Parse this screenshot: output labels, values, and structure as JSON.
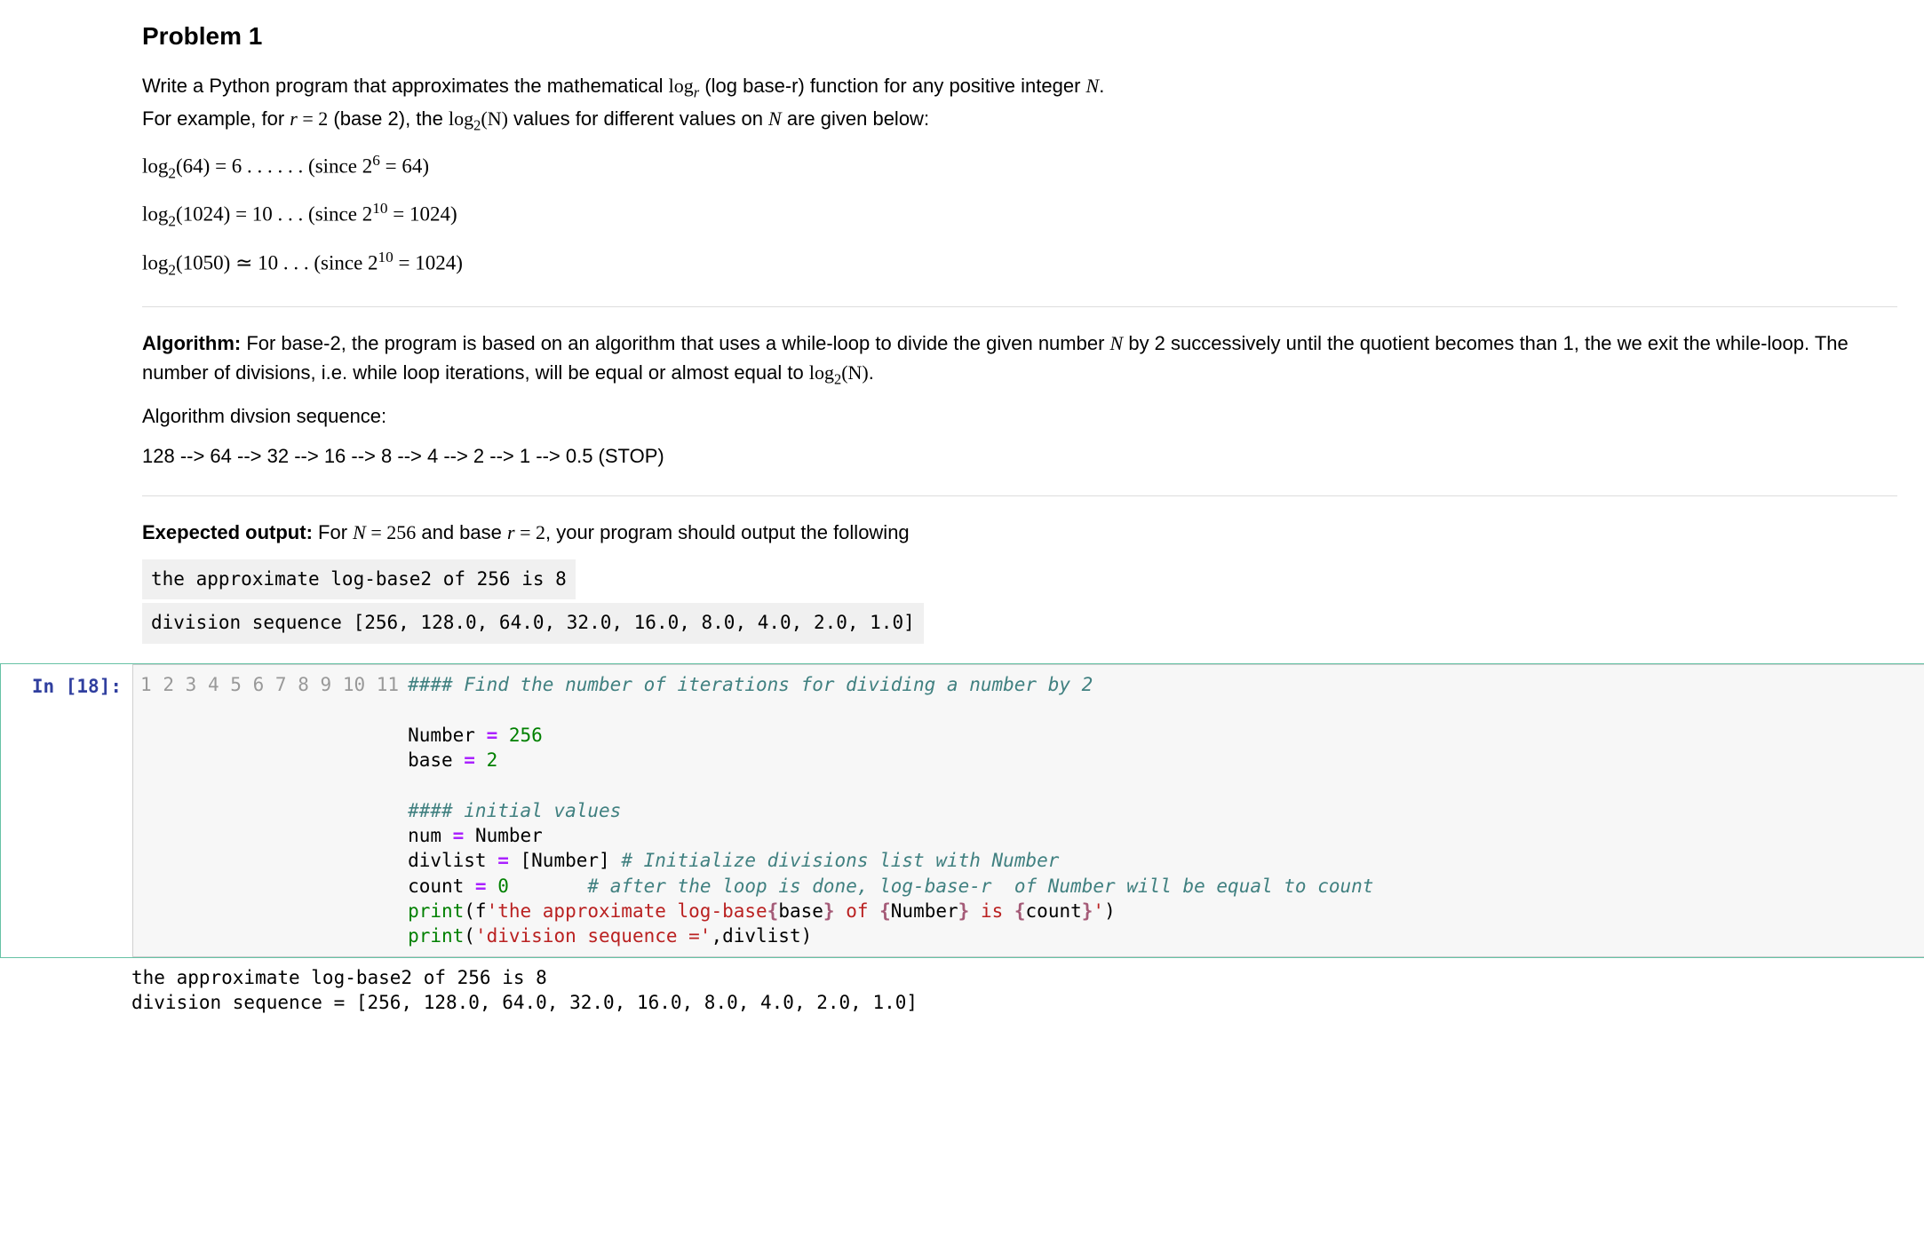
{
  "problem": {
    "heading": "Problem 1",
    "intro_part1": "Write a Python program that approximates the mathematical ",
    "intro_math1": "log",
    "intro_math1_sub": "r",
    "intro_part2": " (log base-r) function for any positive integer ",
    "intro_N": "N",
    "intro_part3": ".",
    "intro2_part1": "For example, for ",
    "intro2_r": "r",
    "intro2_eq": " = 2",
    "intro2_part2": " (base 2), the ",
    "intro2_log": "log",
    "intro2_sub": "2",
    "intro2_paren": "(N)",
    "intro2_part3": " values for different values on ",
    "intro2_N": "N",
    "intro2_part4": " are given below:",
    "examples": {
      "ex1_a": "log",
      "ex1_sub": "2",
      "ex1_b": "(64) = 6 . . . . . . (since 2",
      "ex1_sup": "6",
      "ex1_c": " = 64)",
      "ex2_a": "log",
      "ex2_sub": "2",
      "ex2_b": "(1024) = 10 . . . (since 2",
      "ex2_sup": "10",
      "ex2_c": " = 1024)",
      "ex3_a": "log",
      "ex3_sub": "2",
      "ex3_b": "(1050) ≃ 10 . . . (since 2",
      "ex3_sup": "10",
      "ex3_c": " = 1024)"
    },
    "algorithm": {
      "label": "Algorithm:",
      "text1": " For base-2, the program is based on an algorithm that uses a while-loop to divide the given number ",
      "N": "N",
      "text2": " by 2 successively until the quotient becomes than 1, the we exit the while-loop. The number of divisions, i.e. while loop iterations, will be equal or almost equal to ",
      "log": "log",
      "log_sub": "2",
      "log_paren": "(N)",
      "period": ".",
      "seq_label": "Algorithm divsion sequence:",
      "sequence": "128 --> 64 --> 32 --> 16 --> 8 --> 4 --> 2 --> 1 --> 0.5 (STOP)"
    },
    "expected": {
      "label": "Exepected output:",
      "text1": " For ",
      "N": "N",
      "eq1": " = 256",
      "text2": " and base ",
      "r": "r",
      "eq2": " = 2",
      "text3": ", your program should output the following",
      "out_line1": "the approximate log-base2 of 256 is 8",
      "out_line2": "division sequence [256, 128.0, 64.0, 32.0, 16.0, 8.0, 4.0, 2.0, 1.0]"
    }
  },
  "cell": {
    "prompt": "In [18]:",
    "line_numbers": [
      "1",
      "2",
      "3",
      "4",
      "5",
      "6",
      "7",
      "8",
      "9",
      "10",
      "11"
    ],
    "code": {
      "l1_comment": "#### Find the number of iterations for dividing a number by 2",
      "l3_a": "Number ",
      "l3_op": "=",
      "l3_b": " ",
      "l3_num": "256",
      "l4_a": "base ",
      "l4_op": "=",
      "l4_b": " ",
      "l4_num": "2",
      "l6_comment": "#### initial values",
      "l7_a": "num ",
      "l7_op": "=",
      "l7_b": " Number",
      "l8_a": "divlist ",
      "l8_op": "=",
      "l8_b": " [Number] ",
      "l8_comment": "# Initialize divisions list with Number",
      "l9_a": "count ",
      "l9_op": "=",
      "l9_b": " ",
      "l9_num": "0",
      "l9_pad": "       ",
      "l9_comment": "# after the loop is done, log-base-r  of Number will be equal to count",
      "l10_print": "print",
      "l10_a": "(f",
      "l10_s1": "'the approximate log-base",
      "l10_i1a": "{",
      "l10_i1b": "base",
      "l10_i1c": "}",
      "l10_s2": " of ",
      "l10_i2a": "{",
      "l10_i2b": "Number",
      "l10_i2c": "}",
      "l10_s3": " is ",
      "l10_i3a": "{",
      "l10_i3b": "count",
      "l10_i3c": "}",
      "l10_s4": "'",
      "l10_b": ")",
      "l11_print": "print",
      "l11_a": "(",
      "l11_str": "'division sequence ='",
      "l11_b": ",divlist)"
    },
    "output": {
      "line1": "the approximate log-base2 of 256 is 8",
      "line2": "division sequence = [256, 128.0, 64.0, 32.0, 16.0, 8.0, 4.0, 2.0, 1.0]"
    }
  }
}
